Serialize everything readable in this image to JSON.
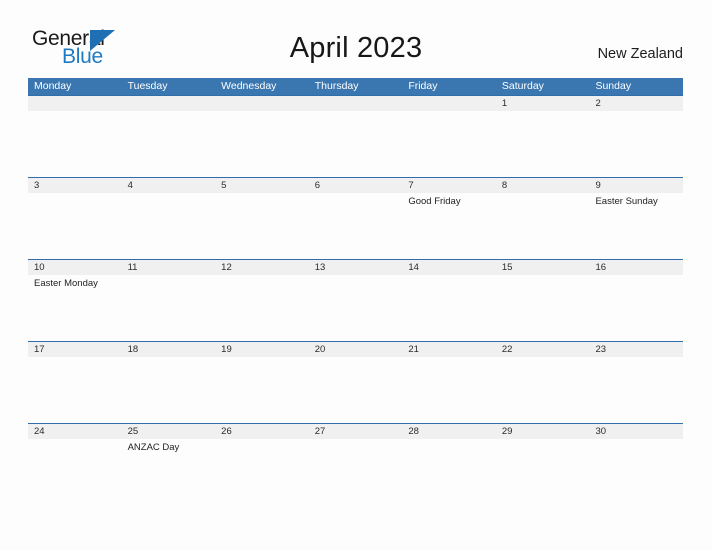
{
  "brand": {
    "name_part1": "General",
    "name_part2": "Blue",
    "accent_color": "#1f7ac4",
    "triangle_icon": "triangle-icon"
  },
  "header": {
    "title": "April 2023",
    "region": "New Zealand"
  },
  "theme": {
    "header_blue": "#3a77b0",
    "divider_blue": "#2f6ea8",
    "date_band_gray": "#f0f0f0",
    "page_background": "#fdfdfd",
    "text_dark": "#222222"
  },
  "calendar": {
    "weekdays": [
      "Monday",
      "Tuesday",
      "Wednesday",
      "Thursday",
      "Friday",
      "Saturday",
      "Sunday"
    ],
    "weeks": [
      {
        "days": [
          {
            "date": "",
            "event": ""
          },
          {
            "date": "",
            "event": ""
          },
          {
            "date": "",
            "event": ""
          },
          {
            "date": "",
            "event": ""
          },
          {
            "date": "",
            "event": ""
          },
          {
            "date": "1",
            "event": ""
          },
          {
            "date": "2",
            "event": ""
          }
        ]
      },
      {
        "days": [
          {
            "date": "3",
            "event": ""
          },
          {
            "date": "4",
            "event": ""
          },
          {
            "date": "5",
            "event": ""
          },
          {
            "date": "6",
            "event": ""
          },
          {
            "date": "7",
            "event": "Good Friday"
          },
          {
            "date": "8",
            "event": ""
          },
          {
            "date": "9",
            "event": "Easter Sunday"
          }
        ]
      },
      {
        "days": [
          {
            "date": "10",
            "event": "Easter Monday"
          },
          {
            "date": "11",
            "event": ""
          },
          {
            "date": "12",
            "event": ""
          },
          {
            "date": "13",
            "event": ""
          },
          {
            "date": "14",
            "event": ""
          },
          {
            "date": "15",
            "event": ""
          },
          {
            "date": "16",
            "event": ""
          }
        ]
      },
      {
        "days": [
          {
            "date": "17",
            "event": ""
          },
          {
            "date": "18",
            "event": ""
          },
          {
            "date": "19",
            "event": ""
          },
          {
            "date": "20",
            "event": ""
          },
          {
            "date": "21",
            "event": ""
          },
          {
            "date": "22",
            "event": ""
          },
          {
            "date": "23",
            "event": ""
          }
        ]
      },
      {
        "days": [
          {
            "date": "24",
            "event": ""
          },
          {
            "date": "25",
            "event": "ANZAC Day"
          },
          {
            "date": "26",
            "event": ""
          },
          {
            "date": "27",
            "event": ""
          },
          {
            "date": "28",
            "event": ""
          },
          {
            "date": "29",
            "event": ""
          },
          {
            "date": "30",
            "event": ""
          }
        ]
      }
    ]
  }
}
